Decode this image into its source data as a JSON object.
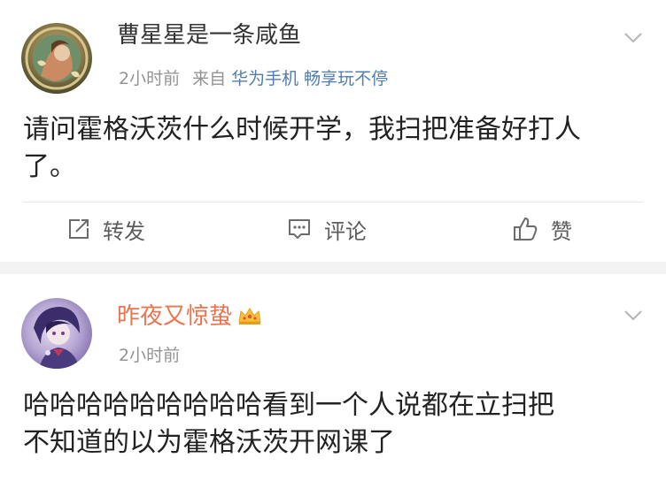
{
  "posts": [
    {
      "username": "曹星星是一条咸鱼",
      "time": "2小时前",
      "source_prefix": "来自",
      "source_device": "华为手机 畅享玩不停",
      "text_lines": [
        "请问霍格沃茨什么时候开学，我扫把准备好打人",
        "了。"
      ],
      "actions": {
        "repost": "转发",
        "comment": "评论",
        "like": "赞"
      }
    },
    {
      "username": "昨夜又惊蛰",
      "time": "2小时前",
      "text_lines": [
        "哈哈哈哈哈哈哈哈哈看到一个人说都在立扫把",
        "不知道的以为霍格沃茨开网课了"
      ]
    }
  ],
  "colors": {
    "vip_name": "#eb7350",
    "link": "#507daf",
    "meta": "#939393"
  },
  "icons": {
    "post1_avatar": "art-nouveau-portrait",
    "post2_avatar": "anime-character-purple",
    "crown": "vip-crown-icon",
    "menu": "chevron-down-icon",
    "repost": "repost-icon",
    "comment": "comment-icon",
    "like": "thumbs-up-icon"
  }
}
